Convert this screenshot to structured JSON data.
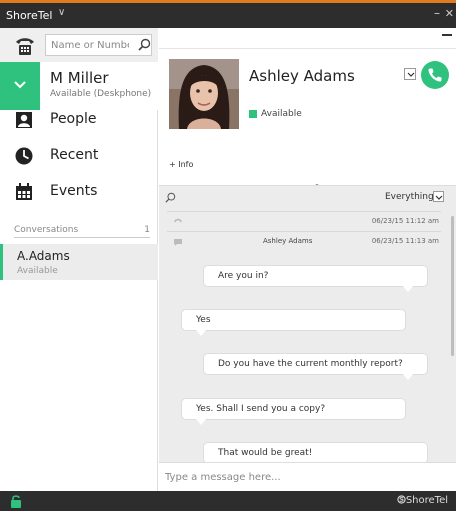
{
  "window": {
    "title": "ShoreTel",
    "title_caret": "∨",
    "minimize": "–",
    "close": "✕"
  },
  "search": {
    "placeholder": "Name or Number"
  },
  "user": {
    "name": "M Miller",
    "status": "Available (Deskphone)"
  },
  "nav": {
    "items": [
      {
        "label": "People"
      },
      {
        "label": "Recent"
      },
      {
        "label": "Events"
      }
    ]
  },
  "conversations": {
    "label": "Conversations",
    "count": "1",
    "items": [
      {
        "name": "A.Adams",
        "status": "Available"
      }
    ]
  },
  "contact": {
    "name": "Ashley Adams",
    "presence": "Available",
    "info_link": "+ Info"
  },
  "conversation": {
    "filter": "Everything",
    "history": [
      {
        "who": "",
        "time": "06/23/15 11:12 am"
      },
      {
        "who": "Ashley Adams",
        "time": "06/23/15 11:13 am"
      }
    ],
    "messages": [
      {
        "text": "Are you in?",
        "side": "right"
      },
      {
        "text": "Yes",
        "side": "left"
      },
      {
        "text": "Do you have the current monthly report?",
        "side": "right"
      },
      {
        "text": "Yes. Shall I send you a copy?",
        "side": "left"
      },
      {
        "text": "That would be great!",
        "side": "right"
      }
    ]
  },
  "composer": {
    "placeholder": "Type a message here..."
  },
  "footer": {
    "brand": "ShoreTel"
  },
  "colors": {
    "accent_green": "#2ec27e",
    "titlebar_bg": "#2d2d2d",
    "titlebar_top": "#e07b1f"
  }
}
